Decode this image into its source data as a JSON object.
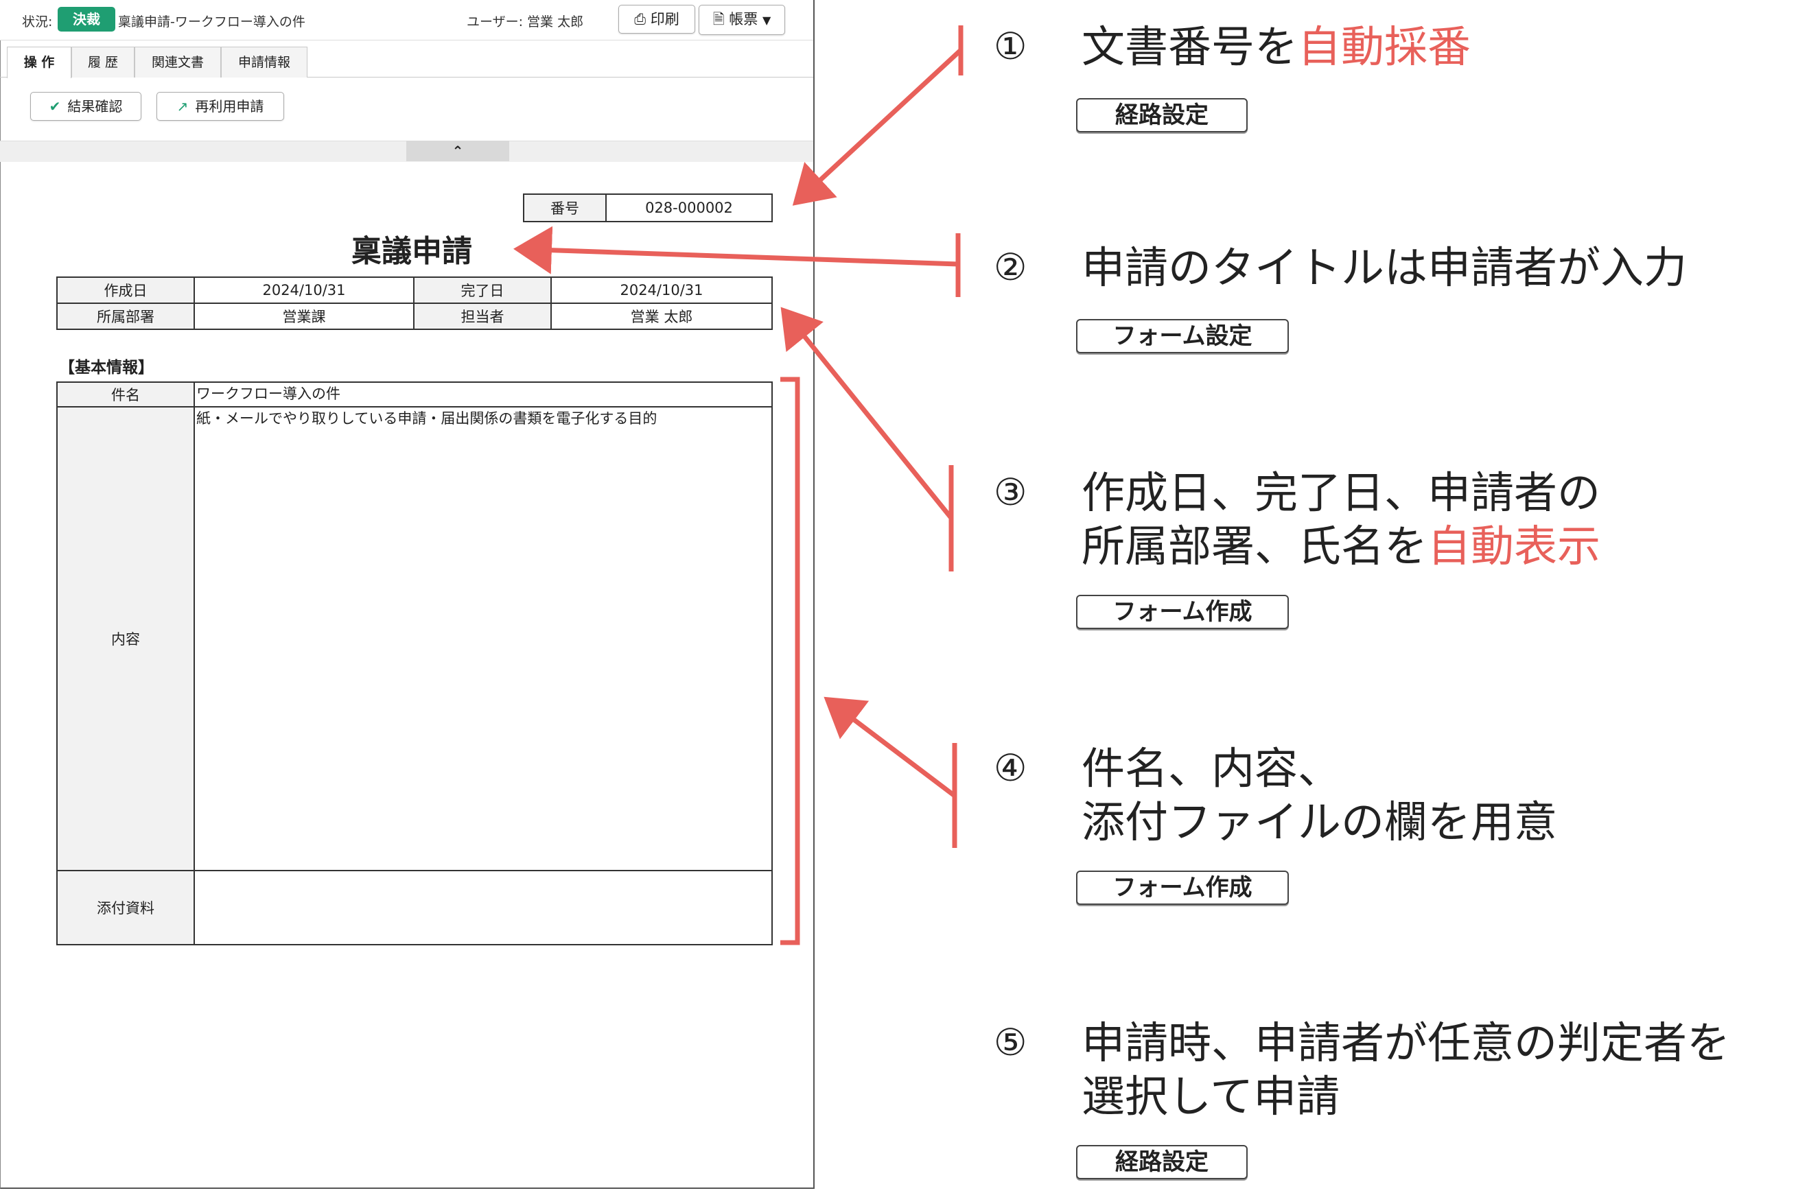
{
  "app": {
    "status_label": "状況:",
    "status_badge": "決裁",
    "doc_title": "稟議申請-ワークフロー導入の件",
    "user_label": "ユーザー: 営業 太郎",
    "print_button": "印刷",
    "form_button": "帳票"
  },
  "tabs": [
    {
      "label": "操 作"
    },
    {
      "label": "履 歴"
    },
    {
      "label": "関連文書"
    },
    {
      "label": "申請情報"
    }
  ],
  "actions": {
    "confirm_result": "結果確認",
    "reuse_apply": "再利用申請"
  },
  "form": {
    "number_label": "番号",
    "number_value": "028-000002",
    "title": "稟議申請",
    "meta": {
      "created_label": "作成日",
      "created_value": "2024/10/31",
      "completed_label": "完了日",
      "completed_value": "2024/10/31",
      "department_label": "所属部署",
      "department_value": "営業課",
      "person_label": "担当者",
      "person_value": "営業 太郎"
    },
    "section_label": "【基本情報】",
    "info": {
      "subject_label": "件名",
      "subject_value": "ワークフロー導入の件",
      "content_label": "内容",
      "content_value": "紙・メールでやり取りしている申請・届出関係の書類を電子化する目的",
      "attachment_label": "添付資料",
      "attachment_value": ""
    }
  },
  "annotations": [
    {
      "num": "①",
      "lines": [
        [
          "文書番号を",
          ""
        ],
        [
          "",
          "自動採番"
        ]
      ],
      "tag": "経路設定"
    },
    {
      "num": "②",
      "line1": "申請のタイトルは申請者が入力",
      "tag": "フォーム設定"
    },
    {
      "num": "③",
      "line1": "作成日、完了日、申請者の",
      "line2_plain": "所属部署、氏名を",
      "line2_hl": "自動表示",
      "tag": "フォーム作成"
    },
    {
      "num": "④",
      "line1": "件名、内容、",
      "line2": "添付ファイルの欄を用意",
      "tag": "フォーム作成"
    },
    {
      "num": "⑤",
      "line1": "申請時、申請者が任意の判定者を",
      "line2": "選択して申請",
      "tag": "経路設定"
    }
  ],
  "annotation1": {
    "plain": "文書番号を",
    "hl": "自動採番"
  },
  "colors": {
    "accent_green": "#1f9e72",
    "highlight_red": "#e8605a"
  }
}
